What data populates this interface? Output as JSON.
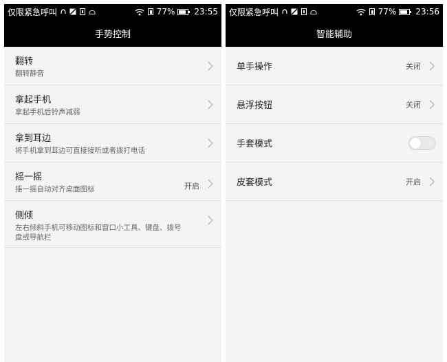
{
  "left": {
    "status": {
      "carrier": "仅限紧急呼叫",
      "battery_pct_text": "77%",
      "battery_level": 0.77,
      "time": "23:55"
    },
    "title": "手势控制",
    "items": [
      {
        "title": "翻转",
        "subtitle": "翻转静音",
        "value": ""
      },
      {
        "title": "拿起手机",
        "subtitle": "拿起手机后铃声减弱",
        "value": ""
      },
      {
        "title": "拿到耳边",
        "subtitle": "将手机拿到耳边可直接接听或者拨打电话",
        "value": ""
      },
      {
        "title": "摇一摇",
        "subtitle": "摇一摇自动对齐桌面图标",
        "value": "开启"
      },
      {
        "title": "侧倾",
        "subtitle": "左右倾斜手机可移动图标和窗口小工具、键盘、拨号盘或导航栏",
        "value": ""
      }
    ]
  },
  "right": {
    "status": {
      "carrier": "仅限紧急呼叫",
      "battery_pct_text": "77%",
      "battery_level": 0.77,
      "time": "23:56"
    },
    "title": "智能辅助",
    "items": [
      {
        "title": "单手操作",
        "value": "关闭"
      },
      {
        "title": "悬浮按钮",
        "value": "关闭"
      },
      {
        "title": "手套模式",
        "toggle_on": false
      },
      {
        "title": "皮套模式",
        "value": "开启"
      }
    ]
  },
  "icons": [
    "nfc-icon",
    "notification-icon",
    "sim-icon",
    "android-icon",
    "wifi-icon",
    "sim-card-icon",
    "battery-icon",
    "chevron-right-icon"
  ]
}
